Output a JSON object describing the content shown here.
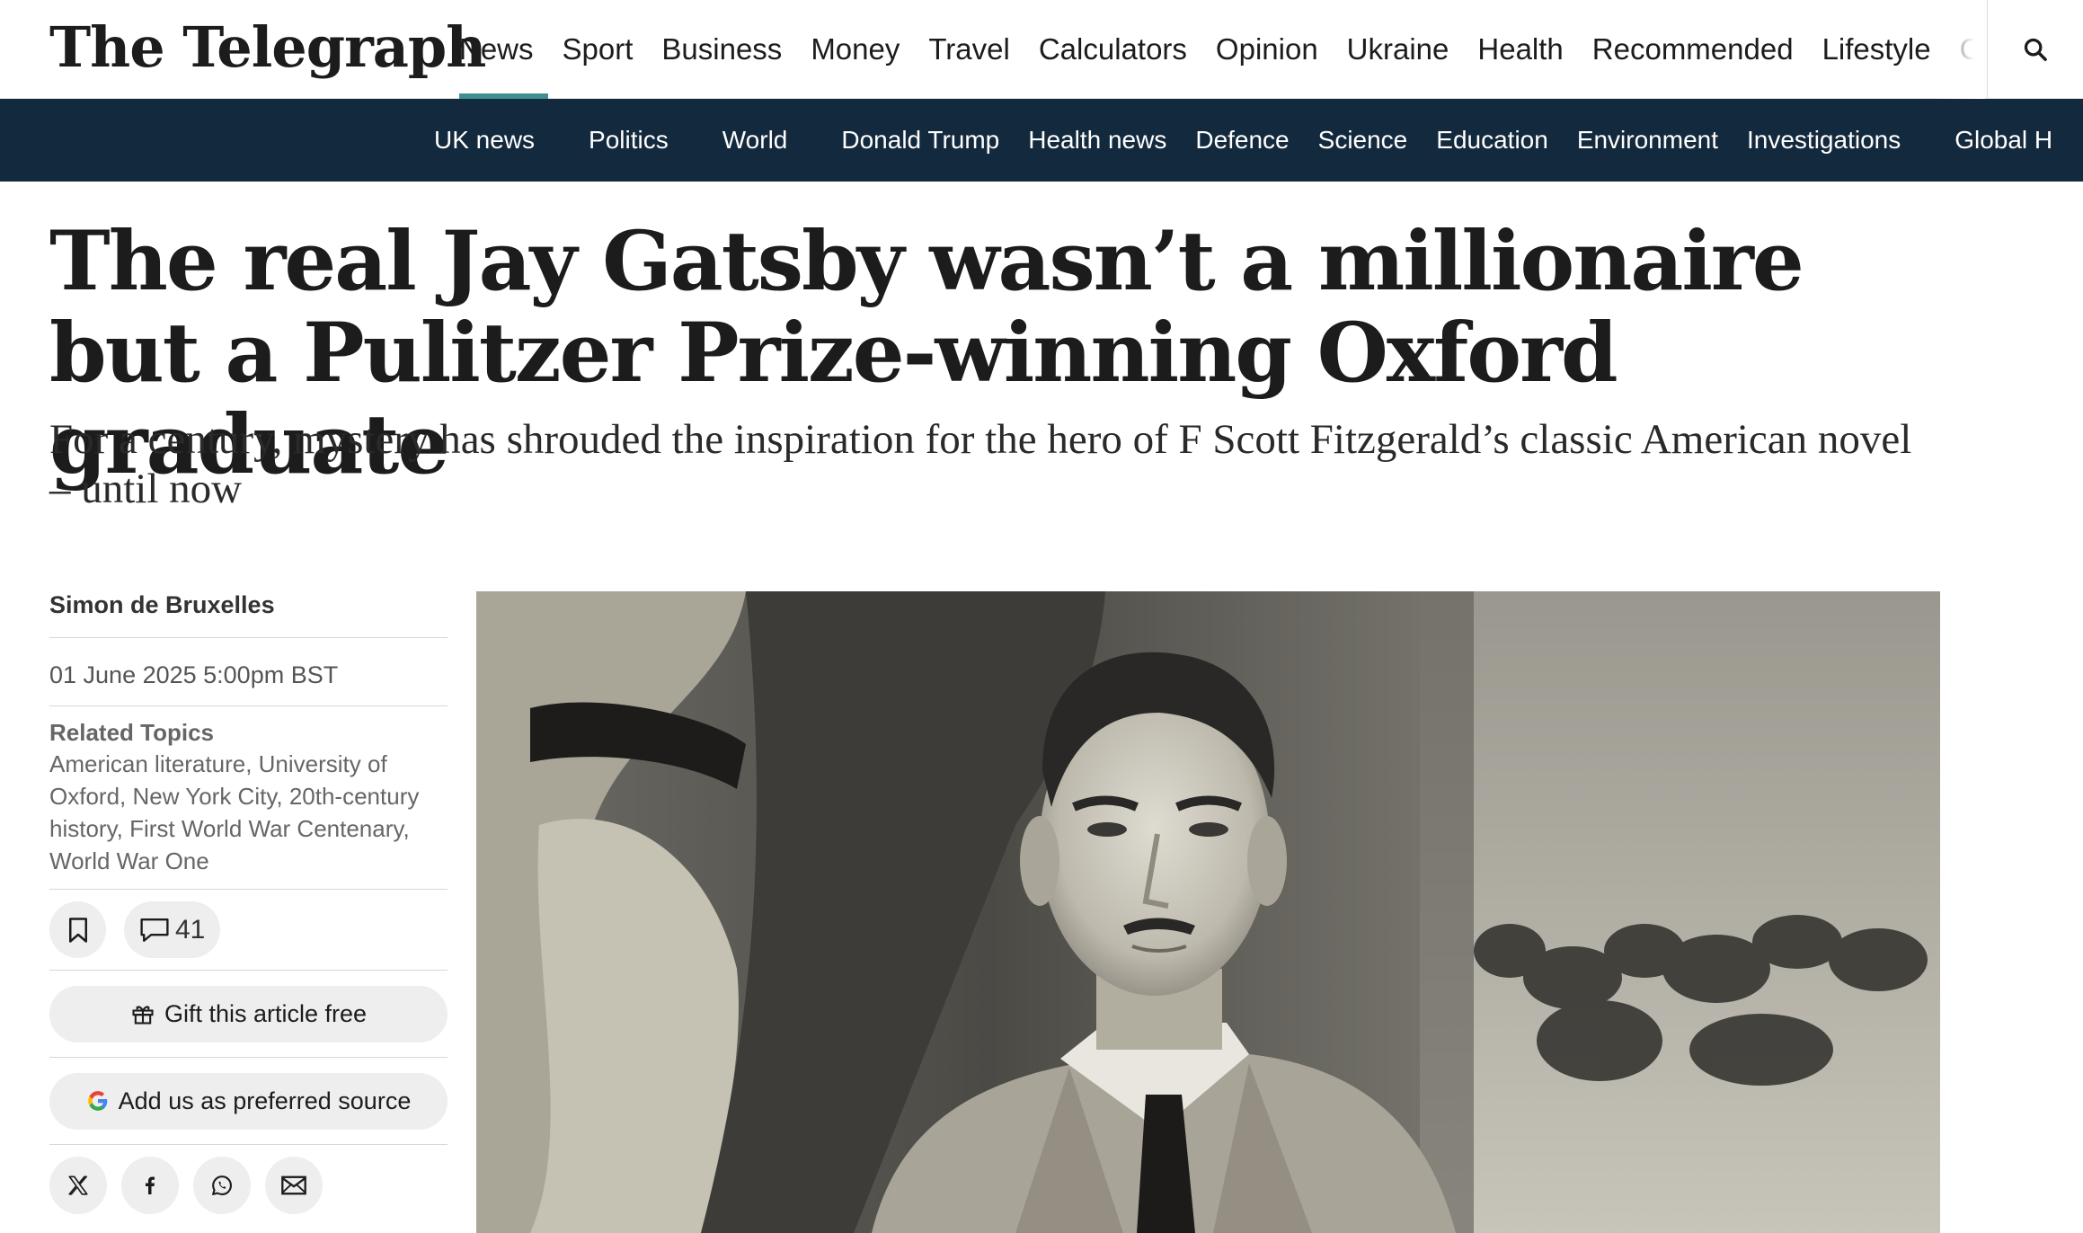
{
  "header": {
    "logo": "The Telegraph",
    "nav": [
      "News",
      "Sport",
      "Business",
      "Money",
      "Travel",
      "Calculators",
      "Opinion",
      "Ukraine",
      "Health",
      "Recommended",
      "Lifestyle",
      "C"
    ],
    "active_nav": "News",
    "accent_color": "#3f8f8f",
    "search_icon": "search-icon"
  },
  "subnav": {
    "background": "#13293d",
    "items": [
      "UK news",
      "Politics",
      "World",
      "Donald Trump",
      "Health news",
      "Defence",
      "Science",
      "Education",
      "Environment",
      "Investigations",
      "Global H"
    ]
  },
  "article": {
    "headline": "The real Jay Gatsby wasn’t a millionaire but a Pulitzer Prize-winning Oxford graduate",
    "standfirst": "For a century, mystery has shrouded the inspiration for the hero of F Scott Fitzgerald’s classic American novel – until now",
    "author": "Simon de Bruxelles",
    "published": "01 June 2025 5:00pm BST",
    "related_title": "Related Topics",
    "related_topics": "American literature, University of Oxford, New York City, 20th-century history, First World War Centenary, World War One",
    "comment_count": "41",
    "gift_label": "Gift this article free",
    "preferred_source_label": "Add us as preferred source",
    "share_icons": [
      "x-icon",
      "facebook-icon",
      "whatsapp-icon",
      "email-icon"
    ]
  }
}
